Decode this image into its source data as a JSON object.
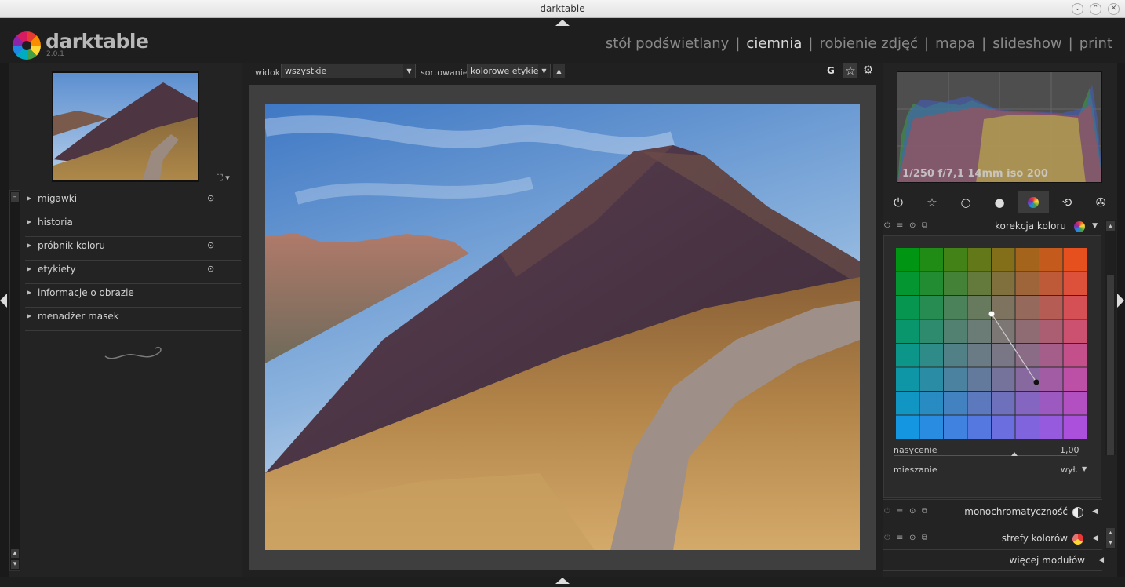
{
  "window": {
    "title": "darktable",
    "controls": [
      "minimize-icon",
      "maximize-icon",
      "close-icon"
    ]
  },
  "app": {
    "name": "darktable",
    "version": "2.0.1"
  },
  "views": [
    {
      "label": "stół podświetlany",
      "active": false
    },
    {
      "label": "ciemnia",
      "active": true
    },
    {
      "label": "robienie zdjęć",
      "active": false
    },
    {
      "label": "mapa",
      "active": false
    },
    {
      "label": "slideshow",
      "active": false
    },
    {
      "label": "print",
      "active": false
    }
  ],
  "view_separator": "|",
  "filmstrip_bar": {
    "view_label": "widok",
    "view_value": "wszystkie",
    "sort_label": "sortowanie",
    "sort_value": "kolorowe etykiety",
    "grouping_label": "G",
    "icons": [
      "star-icon",
      "gear-icon"
    ]
  },
  "left_modules": [
    {
      "label": "migawki",
      "has_icon": true
    },
    {
      "label": "historia",
      "has_icon": false
    },
    {
      "label": "próbnik koloru",
      "has_icon": true
    },
    {
      "label": "etykiety",
      "has_icon": true
    },
    {
      "label": "informacje o obrazie",
      "has_icon": false
    },
    {
      "label": "menadżer masek",
      "has_icon": false
    }
  ],
  "histogram": {
    "info": "1/250 f/7,1 14mm iso 200"
  },
  "module_groups": [
    "power-icon",
    "star-outline-icon",
    "circle-icon",
    "sphere-icon",
    "color-wheel-icon",
    "rotate-icon",
    "effects-icon"
  ],
  "active_group_index": 4,
  "color_correction": {
    "name": "korekcja koloru",
    "saturation_label": "nasycenie",
    "saturation_value": "1,00",
    "saturation_level": 0.66,
    "blend_label": "mieszanie",
    "blend_value": "wył."
  },
  "other_modules": [
    {
      "name": "monochromatyczność",
      "icon": "monochrome-icon"
    },
    {
      "name": "strefy kolorów",
      "icon": "color-zones-icon"
    }
  ],
  "more_modules_label": "więcej modułów",
  "colors": {
    "background": "#202020",
    "panel": "#232323",
    "canvas": "#3f3f3f",
    "text": "#c8c8c8",
    "active_view": "#d8d8d8"
  }
}
